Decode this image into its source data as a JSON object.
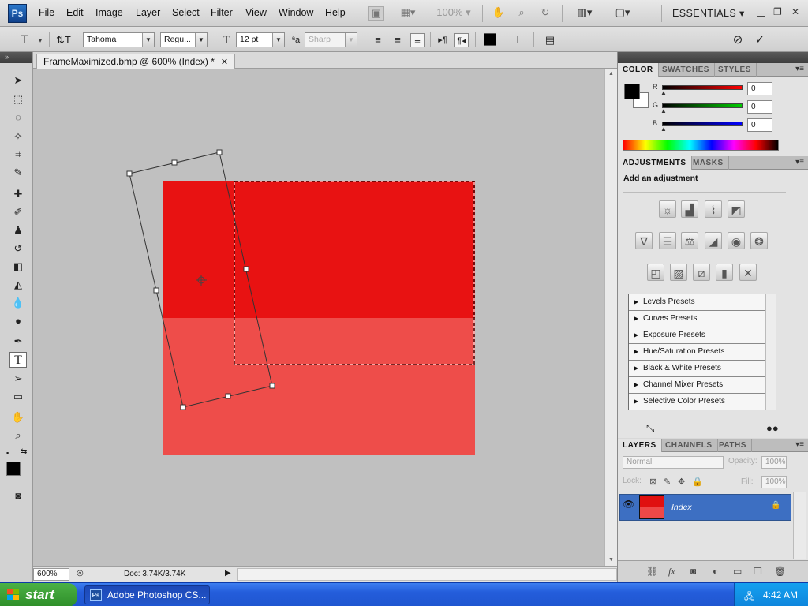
{
  "menubar": {
    "logo": "Ps",
    "items": [
      "File",
      "Edit",
      "Image",
      "Layer",
      "Select",
      "Filter",
      "View",
      "Window",
      "Help"
    ],
    "zoom": "100%",
    "workspace": "ESSENTIALS"
  },
  "options": {
    "font_family": "Tahoma",
    "font_style": "Regu...",
    "font_size": "12 pt",
    "antialias": "Sharp",
    "text_color": "#000000"
  },
  "document": {
    "tab_title": "FrameMaximized.bmp @ 600% (Index) *",
    "zoom": "600%",
    "doc_size": "Doc: 3.74K/3.74K",
    "colors": {
      "top": "#e81212",
      "bottom": "#ee4d4a"
    }
  },
  "color_panel": {
    "tabs": [
      "COLOR",
      "SWATCHES",
      "STYLES"
    ],
    "channels": [
      {
        "label": "R",
        "value": "0"
      },
      {
        "label": "G",
        "value": "0"
      },
      {
        "label": "B",
        "value": "0"
      }
    ]
  },
  "adjustments_panel": {
    "tabs": [
      "ADJUSTMENTS",
      "MASKS"
    ],
    "title": "Add an adjustment",
    "presets": [
      "Levels Presets",
      "Curves Presets",
      "Exposure Presets",
      "Hue/Saturation Presets",
      "Black & White Presets",
      "Channel Mixer Presets",
      "Selective Color Presets"
    ]
  },
  "layers_panel": {
    "tabs": [
      "LAYERS",
      "CHANNELS",
      "PATHS"
    ],
    "blend_mode": "Normal",
    "opacity_label": "Opacity:",
    "opacity": "100%",
    "lock_label": "Lock:",
    "fill_label": "Fill:",
    "fill": "100%",
    "layer_name": "Index"
  },
  "taskbar": {
    "start": "start",
    "task_item": "Adobe Photoshop CS...",
    "clock": "4:42 AM"
  }
}
